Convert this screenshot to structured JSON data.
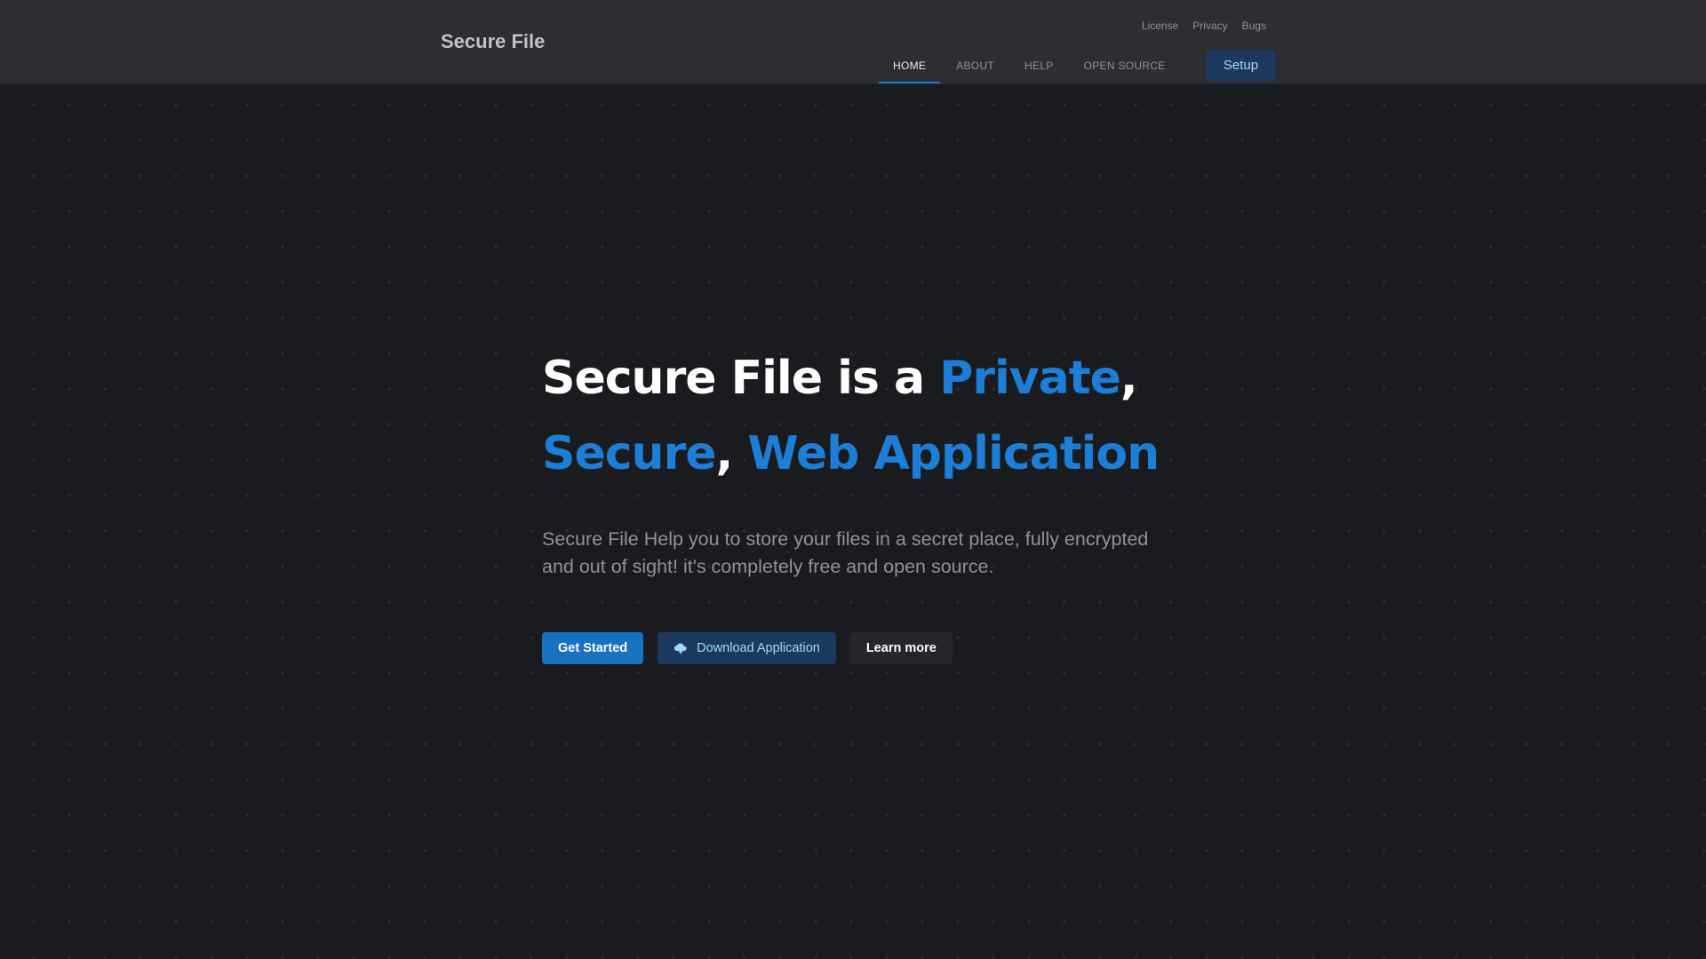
{
  "header": {
    "brand": "Secure File",
    "secondary_links": [
      "License",
      "Privacy",
      "Bugs"
    ],
    "tabs": [
      {
        "label": "HOME",
        "active": true
      },
      {
        "label": "ABOUT",
        "active": false
      },
      {
        "label": "HELP",
        "active": false
      },
      {
        "label": "OPEN SOURCE",
        "active": false
      }
    ],
    "setup_label": "Setup"
  },
  "hero": {
    "title_part1": "Secure File is a ",
    "title_hl1": "Private",
    "title_sep1": ",",
    "title_hl2": "Secure",
    "title_sep2": ", ",
    "title_hl3": "Web Application",
    "description": "Secure File Help you to store your files in a secret place, fully encrypted and out of sight! it's completely free and open source.",
    "buttons": {
      "get_started": "Get Started",
      "download": "Download Application",
      "learn_more": "Learn more"
    },
    "download_icon": "cloud-download-icon"
  },
  "colors": {
    "accent": "#1c7ed6",
    "header_bg": "#2c2e33",
    "page_bg": "#1a1b1e"
  }
}
